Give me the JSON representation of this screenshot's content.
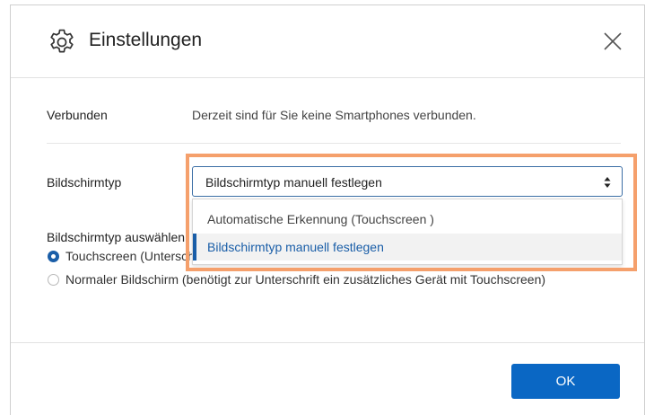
{
  "dialog": {
    "title": "Einstellungen",
    "icon": "gear-icon",
    "close_icon": "close-icon"
  },
  "connected": {
    "label": "Verbunden",
    "text": "Derzeit sind für Sie keine Smartphones verbunden."
  },
  "screen_type": {
    "label": "Bildschirmtyp",
    "selected": "Bildschirmtyp manuell festlegen",
    "options": [
      "Automatische Erkennung (Touchscreen )",
      "Bildschirmtyp manuell festlegen"
    ]
  },
  "select_screen": {
    "label": "Bildschirmtyp auswählen",
    "options": [
      {
        "label": "Touchscreen (Unterschrift direkt auf dem Bildschirm)",
        "checked": true
      },
      {
        "label": "Normaler Bildschirm (benötigt zur Unterschrift ein zusätzliches Gerät mit Touchscreen)",
        "checked": false
      }
    ]
  },
  "footer": {
    "ok_label": "OK"
  },
  "colors": {
    "accent": "#0a67c4",
    "highlight_frame": "#f5a06c"
  }
}
